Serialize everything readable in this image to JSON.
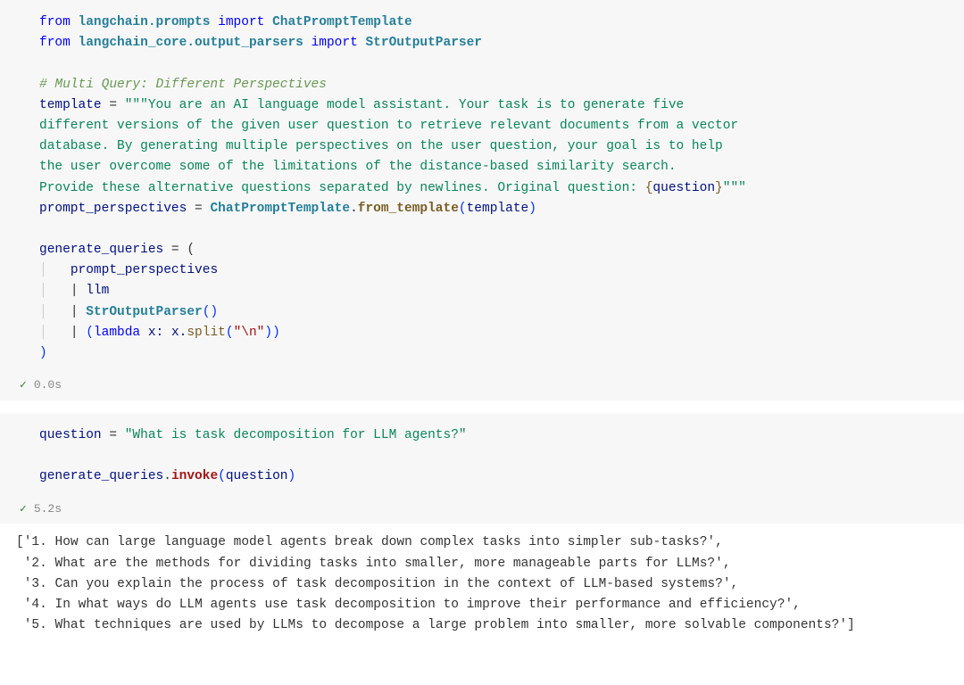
{
  "cell1": {
    "line1": {
      "kw1": "from",
      "mod1": "langchain.prompts",
      "kw2": "import",
      "cls1": "ChatPromptTemplate"
    },
    "line2": {
      "kw1": "from",
      "mod1": "langchain_core.output_parsers",
      "kw2": "import",
      "cls1": "StrOutputParser"
    },
    "comment": "# Multi Query: Different Perspectives",
    "assign1": {
      "var": "template",
      "eq": " = ",
      "q3a": "\"\"\"",
      "s1": "You are an AI language model assistant. Your task is to generate five ",
      "s2": "different versions of the given user question to retrieve relevant documents from a vector ",
      "s3": "database. By generating multiple perspectives on the user question, your goal is to help ",
      "s4": "the user overcome some of the limitations of the distance-based similarity search. ",
      "s5": "Provide these alternative questions separated by newlines. Original question: ",
      "ph_open": "{",
      "ph": "question",
      "ph_close": "}",
      "q3b": "\"\"\""
    },
    "assign2": {
      "var": "prompt_perspectives",
      "eq": " = ",
      "cls": "ChatPromptTemplate",
      "dot": ".",
      "fn": "from_template",
      "open": "(",
      "arg": "template",
      "close": ")"
    },
    "assign3": {
      "var": "generate_queries",
      "eq": " = (",
      "close": ")"
    },
    "inner": {
      "l1": "prompt_perspectives",
      "pipe": "| ",
      "l2": "llm",
      "l3a": "StrOutputParser",
      "l3b": "()",
      "l4a": "(",
      "l4kw": "lambda",
      "l4b": " x: x.",
      "l4fn": "split",
      "l4c": "(",
      "l4str": "\"\\n\"",
      "l4d": "))"
    },
    "status": {
      "check": "✓",
      "time": "0.0s"
    }
  },
  "cell2": {
    "assign": {
      "var": "question",
      "eq": " = ",
      "str": "\"What is task decomposition for LLM agents?\""
    },
    "call": {
      "var": "generate_queries",
      "dot": ".",
      "fn": "invoke",
      "open": "(",
      "arg": "question",
      "close": ")"
    },
    "status": {
      "check": "✓",
      "time": "5.2s"
    }
  },
  "output": {
    "l1": "['1. How can large language model agents break down complex tasks into simpler sub-tasks?',",
    "l2": " '2. What are the methods for dividing tasks into smaller, more manageable parts for LLMs?',",
    "l3": " '3. Can you explain the process of task decomposition in the context of LLM-based systems?',",
    "l4": " '4. In what ways do LLM agents use task decomposition to improve their performance and efficiency?',",
    "l5": " '5. What techniques are used by LLMs to decompose a large problem into smaller, more solvable components?']"
  }
}
